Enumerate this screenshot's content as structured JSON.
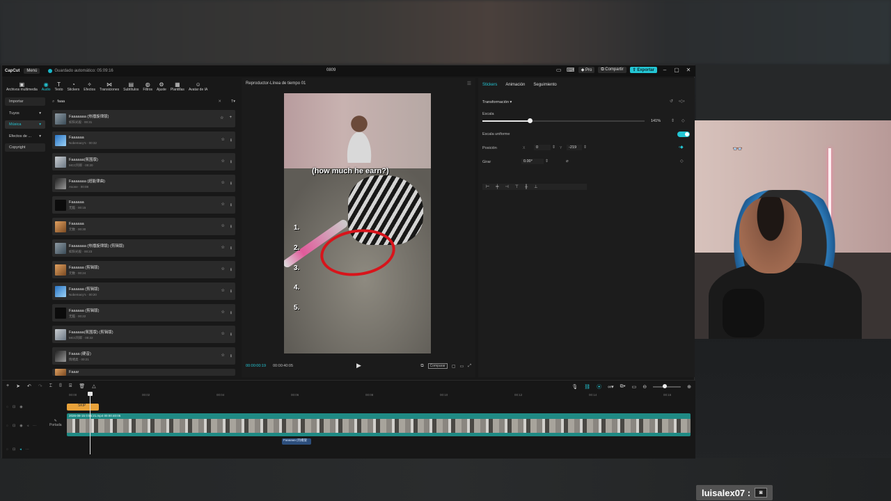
{
  "app": {
    "logo": "CapCut",
    "menu_label": "Menú",
    "autosave_text": "Guardado automático: 05:09:16",
    "project_name": "0809",
    "pro_label": "Pro",
    "share_label": "Compartir",
    "export_label": "Exportar"
  },
  "toolbar": [
    {
      "label": "Archivos multimedia",
      "icon": "media-icon"
    },
    {
      "label": "Audio",
      "icon": "audio-icon"
    },
    {
      "label": "Texto",
      "icon": "text-icon"
    },
    {
      "label": "Stickers",
      "icon": "sticker-icon"
    },
    {
      "label": "Efectos",
      "icon": "effects-icon"
    },
    {
      "label": "Transiciones",
      "icon": "transitions-icon"
    },
    {
      "label": "Subtítulos",
      "icon": "subtitles-icon"
    },
    {
      "label": "Filtros",
      "icon": "filters-icon"
    },
    {
      "label": "Ajuste",
      "icon": "adjust-icon"
    },
    {
      "label": "Plantillas",
      "icon": "templates-icon"
    },
    {
      "label": "Avatar de IA",
      "icon": "ai-avatar-icon"
    }
  ],
  "leftnav": [
    {
      "label": "Importar"
    },
    {
      "label": "Tuyos"
    },
    {
      "label": "Música"
    },
    {
      "label": "Efectos de ..."
    },
    {
      "label": "Copyright"
    }
  ],
  "search": {
    "value": "faaa"
  },
  "sounds": [
    {
      "name": "Faaaaaaa (热播旋律版)",
      "sub": "如阳光般 · 00:31"
    },
    {
      "name": "Faaaaaa",
      "sub": "Nobemacy's · 00:32"
    },
    {
      "name": "Faaaaaa(氛围版)",
      "sub": "MCC阿郎 · 00:20"
    },
    {
      "name": "Faaaaaaa (超能律曲)",
      "sub": "Asone · 00:08"
    },
    {
      "name": "Faaaaaa",
      "sub": "无脑 · 00:15"
    },
    {
      "name": "Faaaaaa",
      "sub": "元数 · 00:30"
    },
    {
      "name": "Faaaaaaa (热播旋律版) (剪辑版)",
      "sub": "如阳光般 · 00:23"
    },
    {
      "name": "Faaaaaa (剪辑版)",
      "sub": "元数 · 00:24"
    },
    {
      "name": "Faaaaaa (剪辑版)",
      "sub": "Nobemacy's · 00:20"
    },
    {
      "name": "Faaaaaa (剪辑版)",
      "sub": "无脑 · 00:22"
    },
    {
      "name": "Faaaaaa(氛围版) (剪辑版)",
      "sub": "MCC阿郎 · 00:22"
    },
    {
      "name": "Faaaa (硬音)",
      "sub": "情绪类 · 00:21"
    },
    {
      "name": "Faaar",
      "sub": ""
    }
  ],
  "player": {
    "title": "Reproductor-Línea de tiempo 01",
    "current_time": "00:00:00:19",
    "total_time": "00:00:40:05",
    "caption": "(how much he earn?)",
    "numbers": [
      "1.",
      "2.",
      "3.",
      "4.",
      "5."
    ],
    "compare_label": "Comparar"
  },
  "inspector": {
    "tabs": [
      "Stickers",
      "Animación",
      "Seguimiento"
    ],
    "section": "Transformación",
    "scale_label": "Escala",
    "scale_value": "141%",
    "scale_fraction": 0.29,
    "uniform_label": "Escala uniforme",
    "position_label": "Posición",
    "pos_x_label": "X",
    "pos_x": "0",
    "pos_y_label": "Y",
    "pos_y": "-219",
    "rotate_label": "Girar",
    "rotate_value": "0.00°"
  },
  "timeline": {
    "ruler": [
      "00:00",
      "00:02",
      "00:04",
      "00:06",
      "00:08",
      "00:10",
      "00:12",
      "00:14",
      "00:16"
    ],
    "clip_header": "2026-08-15 0:55:21.mp4   00:00:40:05",
    "cover_label": "Portada",
    "audio_clip": "Faaaaaa (热播旋",
    "sticker_clip": "SKIP"
  },
  "stream": {
    "username": "luisalex07 :"
  }
}
